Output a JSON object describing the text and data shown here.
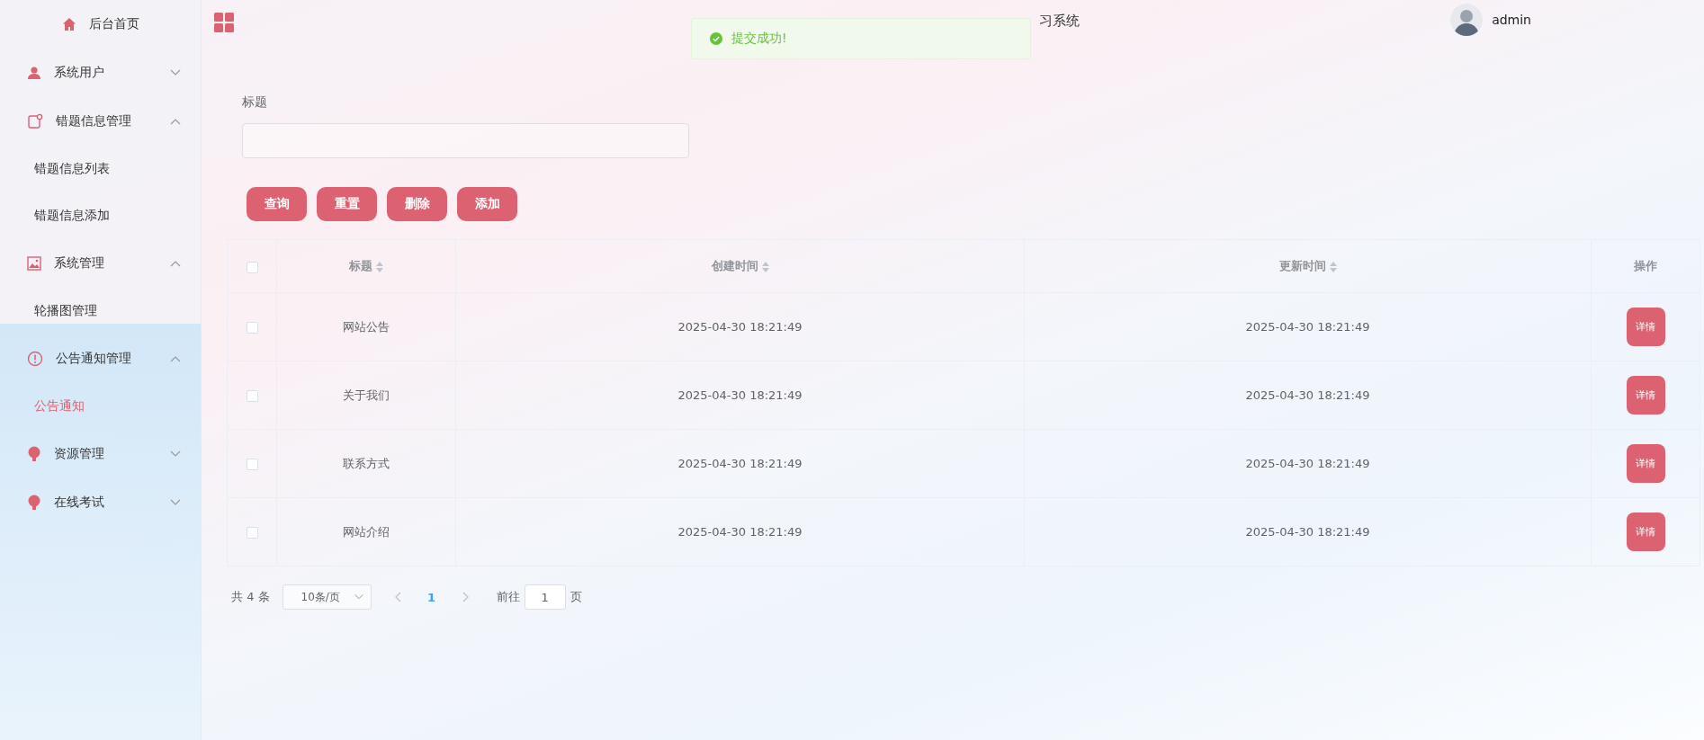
{
  "header": {
    "title": "习系统",
    "user": "admin"
  },
  "toast": {
    "message": "提交成功!"
  },
  "sidebar": {
    "items": [
      {
        "label": "后台首页"
      },
      {
        "label": "系统用户",
        "expanded": false
      },
      {
        "label": "错题信息管理",
        "expanded": true,
        "children": [
          {
            "label": "错题信息列表",
            "selected": false
          },
          {
            "label": "错题信息添加",
            "selected": false
          }
        ]
      },
      {
        "label": "系统管理",
        "expanded": true,
        "children": [
          {
            "label": "轮播图管理",
            "selected": false
          }
        ]
      },
      {
        "label": "公告通知管理",
        "expanded": true,
        "children": [
          {
            "label": "公告通知",
            "selected": true
          }
        ]
      },
      {
        "label": "资源管理",
        "expanded": false
      },
      {
        "label": "在线考试",
        "expanded": false
      }
    ]
  },
  "search": {
    "label": "标题"
  },
  "buttons": [
    "查询",
    "重置",
    "删除",
    "添加"
  ],
  "table": {
    "select_all": {
      "checked": false
    },
    "columns": [
      {
        "label": "标题",
        "sortable": true
      },
      {
        "label": "创建时间",
        "sortable": true
      },
      {
        "label": "更新时间",
        "sortable": true
      },
      {
        "label": "操作",
        "sortable": false
      }
    ],
    "rows": [
      {
        "checked": false,
        "title": "网站公告",
        "created": "2025-04-30 18:21:49",
        "updated": "2025-04-30 18:21:49",
        "action": "详情"
      },
      {
        "checked": false,
        "title": "关于我们",
        "created": "2025-04-30 18:21:49",
        "updated": "2025-04-30 18:21:49",
        "action": "详情"
      },
      {
        "checked": false,
        "title": "联系方式",
        "created": "2025-04-30 18:21:49",
        "updated": "2025-04-30 18:21:49",
        "action": "详情"
      },
      {
        "checked": false,
        "title": "网站介绍",
        "created": "2025-04-30 18:21:49",
        "updated": "2025-04-30 18:21:49",
        "action": "详情"
      }
    ]
  },
  "pagination": {
    "total": "共 4 条",
    "page_size": "10条/页",
    "pages": [
      {
        "label": "1",
        "selected": true
      }
    ],
    "goto_label": "前往",
    "goto_value": "1",
    "goto_suffix": "页"
  }
}
